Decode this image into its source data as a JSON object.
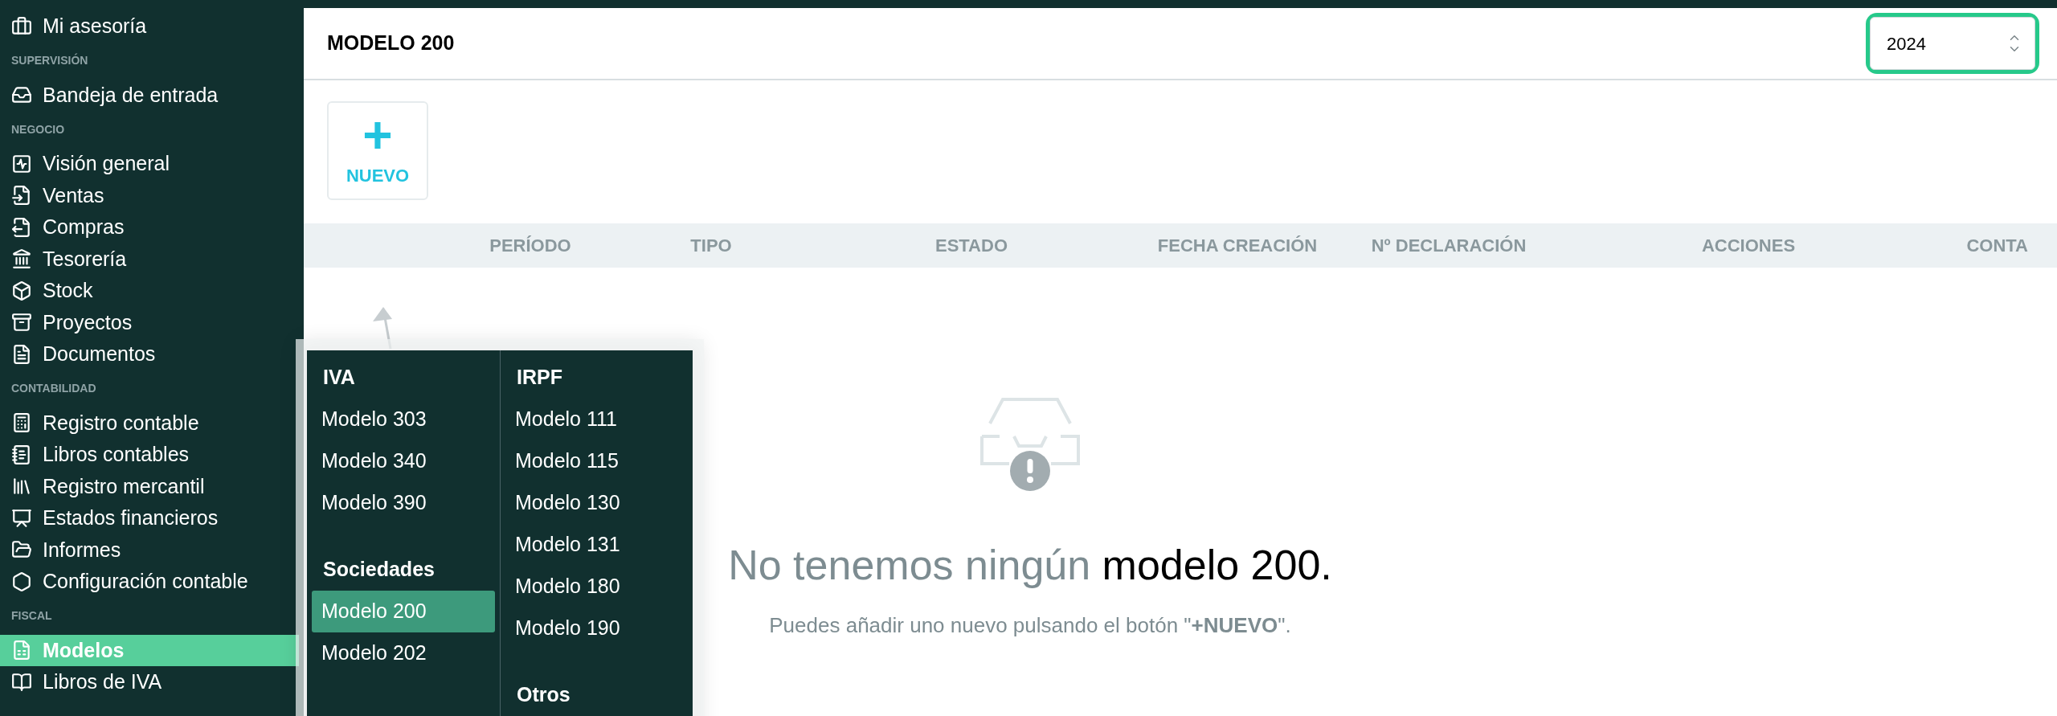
{
  "sidebar": {
    "groups": [
      {
        "items": [
          {
            "label": "Mi asesoría",
            "selected": false
          }
        ]
      },
      {
        "label": "SUPERVISIÓN",
        "items": [
          {
            "label": "Bandeja de entrada",
            "selected": false
          }
        ]
      },
      {
        "label": "NEGOCIO",
        "items": [
          {
            "label": "Visión general",
            "selected": false
          },
          {
            "label": "Ventas",
            "selected": false
          },
          {
            "label": "Compras",
            "selected": false
          },
          {
            "label": "Tesorería",
            "selected": false
          },
          {
            "label": "Stock",
            "selected": false
          },
          {
            "label": "Proyectos",
            "selected": false
          },
          {
            "label": "Documentos",
            "selected": false
          }
        ]
      },
      {
        "label": "CONTABILIDAD",
        "items": [
          {
            "label": "Registro contable",
            "selected": false
          },
          {
            "label": "Libros contables",
            "selected": false
          },
          {
            "label": "Registro mercantil",
            "selected": false
          },
          {
            "label": "Estados financieros",
            "selected": false
          },
          {
            "label": "Informes",
            "selected": false
          },
          {
            "label": "Configuración contable",
            "selected": false
          }
        ]
      },
      {
        "label": "FISCAL",
        "items": [
          {
            "label": "Modelos",
            "selected": true
          },
          {
            "label": "Libros de IVA",
            "selected": false
          }
        ]
      }
    ]
  },
  "header": {
    "title": "MODELO 200",
    "year": "2024"
  },
  "new_button": {
    "icon": "+",
    "label": "NUEVO"
  },
  "table": {
    "columns": [
      "PERÍODO",
      "TIPO",
      "ESTADO",
      "FECHA CREACIÓN",
      "Nº DECLARACIÓN",
      "ACCIONES",
      "CONTA"
    ]
  },
  "empty_state": {
    "headline_muted": "No tenemos ningún",
    "headline_strong": "modelo 200.",
    "hint": "Puedes añadir uno nuevo pulsando el botón \"**+NUEVO**\"."
  },
  "menu": {
    "columns": [
      {
        "groups": [
          {
            "title": "IVA",
            "items": [
              {
                "label": "Modelo 303",
                "selected": false
              },
              {
                "label": "Modelo 340",
                "selected": false
              },
              {
                "label": "Modelo 390",
                "selected": false
              }
            ]
          },
          {
            "title": "Sociedades",
            "items": [
              {
                "label": "Modelo 200",
                "selected": true
              },
              {
                "label": "Modelo 202",
                "selected": false
              }
            ]
          }
        ]
      },
      {
        "groups": [
          {
            "title": "IRPF",
            "items": [
              {
                "label": "Modelo 111",
                "selected": false
              },
              {
                "label": "Modelo 115",
                "selected": false
              },
              {
                "label": "Modelo 130",
                "selected": false
              },
              {
                "label": "Modelo 131",
                "selected": false
              },
              {
                "label": "Modelo 180",
                "selected": false
              },
              {
                "label": "Modelo 190",
                "selected": false
              }
            ]
          },
          {
            "title": "Otros"
          }
        ]
      }
    ]
  }
}
